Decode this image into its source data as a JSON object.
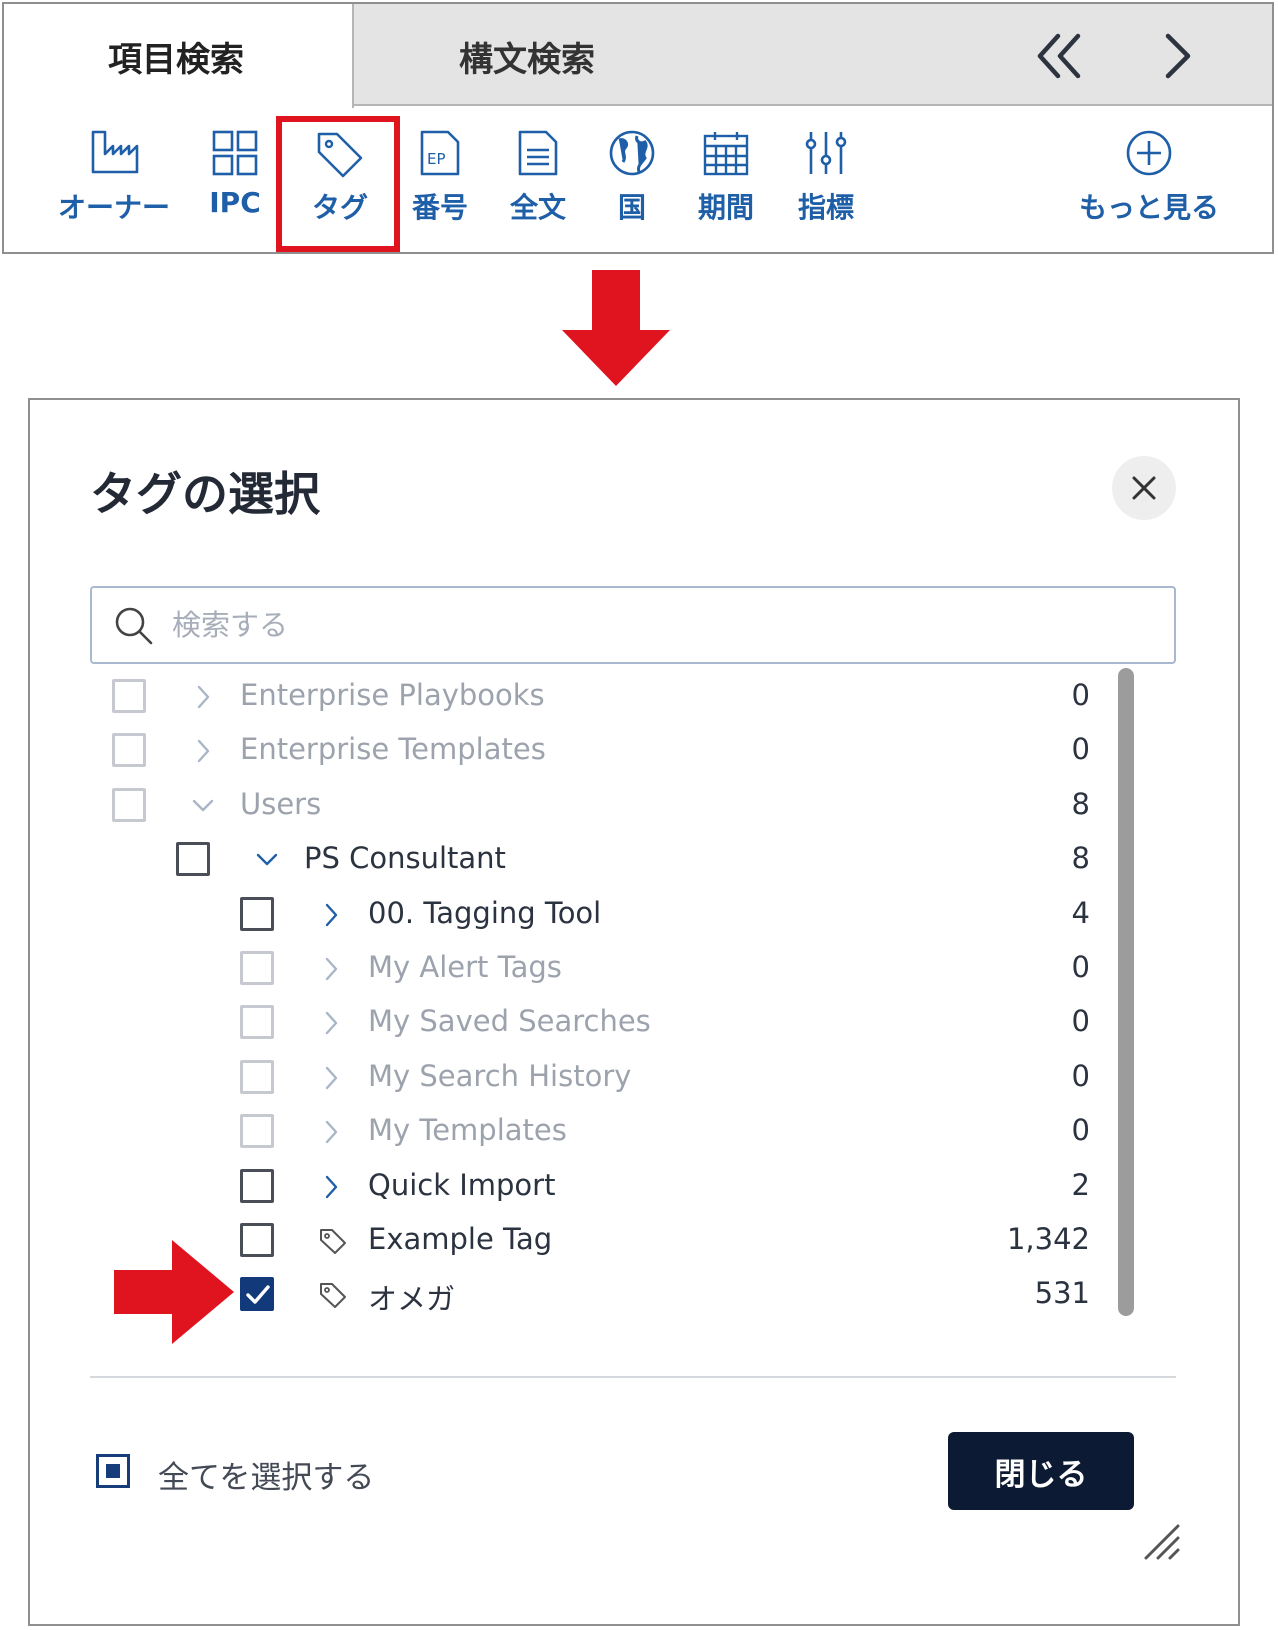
{
  "tabs": [
    {
      "label": "項目検索",
      "active": true
    },
    {
      "label": "構文検索",
      "active": false
    }
  ],
  "tab_nav": {
    "prev_icon": "double-chevron-left-icon",
    "next_icon": "chevron-right-icon"
  },
  "toolbar": {
    "items": [
      {
        "label": "オーナー",
        "icon": "factory-icon"
      },
      {
        "label": "IPC",
        "icon": "grid-icon"
      },
      {
        "label": "タグ",
        "icon": "tag-icon",
        "highlighted": true
      },
      {
        "label": "番号",
        "icon": "ep-document-icon"
      },
      {
        "label": "全文",
        "icon": "document-text-icon"
      },
      {
        "label": "国",
        "icon": "globe-icon"
      },
      {
        "label": "期間",
        "icon": "calendar-icon"
      },
      {
        "label": "指標",
        "icon": "sliders-icon"
      },
      {
        "label": "もっと見る",
        "icon": "plus-circle-icon"
      }
    ]
  },
  "dialog": {
    "title": "タグの選択",
    "close_icon": "close-icon",
    "search": {
      "placeholder": "検索する",
      "value": ""
    },
    "tree": [
      {
        "label": "Enterprise Playbooks",
        "count": "0",
        "level": 0,
        "toggle": "collapsed",
        "enabled": false,
        "checked": false
      },
      {
        "label": "Enterprise Templates",
        "count": "0",
        "level": 0,
        "toggle": "collapsed",
        "enabled": false,
        "checked": false
      },
      {
        "label": "Users",
        "count": "8",
        "level": 0,
        "toggle": "expanded",
        "enabled": false,
        "checked": false
      },
      {
        "label": "PS Consultant",
        "count": "8",
        "level": 1,
        "toggle": "expanded",
        "enabled": true,
        "checked": false
      },
      {
        "label": "00. Tagging Tool",
        "count": "4",
        "level": 2,
        "toggle": "collapsed",
        "enabled": true,
        "checked": false
      },
      {
        "label": "My Alert Tags",
        "count": "0",
        "level": 2,
        "toggle": "collapsed",
        "enabled": false,
        "checked": false
      },
      {
        "label": "My Saved Searches",
        "count": "0",
        "level": 2,
        "toggle": "collapsed",
        "enabled": false,
        "checked": false
      },
      {
        "label": "My Search History",
        "count": "0",
        "level": 2,
        "toggle": "collapsed",
        "enabled": false,
        "checked": false
      },
      {
        "label": "My Templates",
        "count": "0",
        "level": 2,
        "toggle": "collapsed",
        "enabled": false,
        "checked": false
      },
      {
        "label": "Quick Import",
        "count": "2",
        "level": 2,
        "toggle": "collapsed",
        "enabled": true,
        "checked": false
      },
      {
        "label": "Example Tag",
        "count": "1,342",
        "level": 2,
        "toggle": "tag",
        "enabled": true,
        "checked": false
      },
      {
        "label": "オメガ",
        "count": "531",
        "level": 2,
        "toggle": "tag",
        "enabled": true,
        "checked": true
      }
    ],
    "select_all_label": "全てを選択する",
    "close_button_label": "閉じる"
  },
  "colors": {
    "accent_blue": "#1f5fa8",
    "highlight_red": "#e0141e",
    "dark_navy": "#0c1b33",
    "checked_blue": "#123a7a"
  }
}
